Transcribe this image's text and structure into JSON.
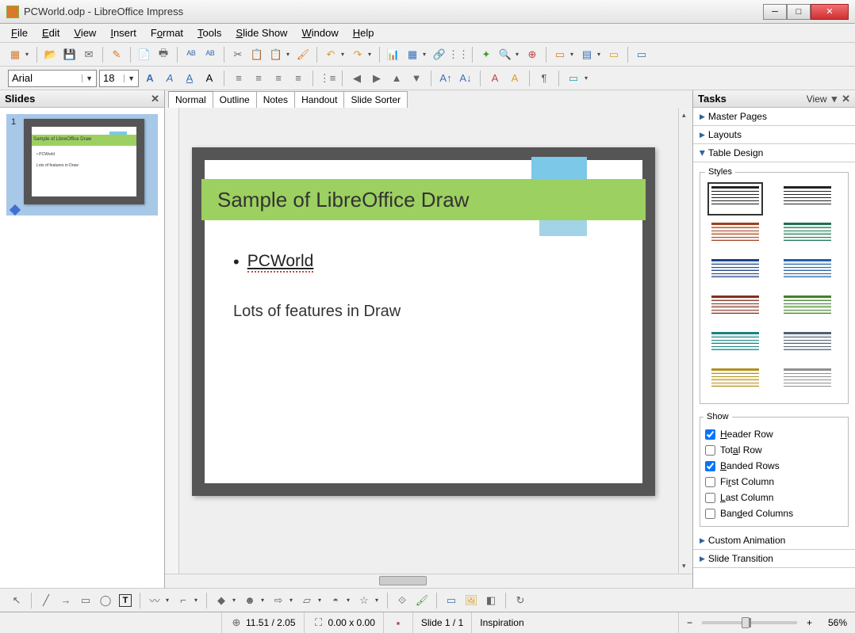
{
  "window": {
    "title": "PCWorld.odp - LibreOffice Impress"
  },
  "menu": {
    "file": "File",
    "edit": "Edit",
    "view": "View",
    "insert": "Insert",
    "format": "Format",
    "tools": "Tools",
    "slideshow": "Slide Show",
    "window": "Window",
    "help": "Help"
  },
  "format_toolbar": {
    "font_name": "Arial",
    "font_size": "18"
  },
  "slides_panel": {
    "title": "Slides",
    "slide_number": "1",
    "mini_title": "Sample of LibreOffice Draw",
    "mini_bullet": "• PCWorld",
    "mini_line": "Lots of features in Draw"
  },
  "view_tabs": {
    "normal": "Normal",
    "outline": "Outline",
    "notes": "Notes",
    "handout": "Handout",
    "sorter": "Slide Sorter"
  },
  "slide": {
    "title": "Sample of LibreOffice Draw",
    "bullet1": "PCWorld",
    "line2": "Lots of features in Draw"
  },
  "tasks": {
    "title": "Tasks",
    "view_label": "View",
    "sections": {
      "master_pages": "Master Pages",
      "layouts": "Layouts",
      "table_design": "Table Design",
      "custom_animation": "Custom Animation",
      "slide_transition": "Slide Transition"
    },
    "styles_legend": "Styles",
    "show_legend": "Show",
    "show_options": {
      "header_row": "Header Row",
      "total_row": "Total Row",
      "banded_rows": "Banded Rows",
      "first_column": "First Column",
      "last_column": "Last Column",
      "banded_columns": "Banded Columns"
    },
    "show_checked": {
      "header_row": true,
      "total_row": false,
      "banded_rows": true,
      "first_column": false,
      "last_column": false,
      "banded_columns": false
    }
  },
  "status": {
    "coords": "11.51 / 2.05",
    "size": "0.00 x 0.00",
    "slide_counter": "Slide 1 / 1",
    "template": "Inspiration",
    "zoom": "56%"
  },
  "style_colors": [
    [
      "#222",
      "#f0f0f0"
    ],
    [
      "#222",
      "#fff"
    ],
    [
      "#a04020",
      "#f4d8c8"
    ],
    [
      "#207050",
      "#c8e8d8"
    ],
    [
      "#204080",
      "#c8d8f0"
    ],
    [
      "#2060a0",
      "#d0e0f4"
    ],
    [
      "#803020",
      "#e8d0c8"
    ],
    [
      "#408030",
      "#d0e8c0"
    ],
    [
      "#208080",
      "#c8e8e8"
    ],
    [
      "#506070",
      "#e0e4e8"
    ],
    [
      "#b09020",
      "#f4ecc8"
    ],
    [
      "#909090",
      "#fff"
    ]
  ]
}
